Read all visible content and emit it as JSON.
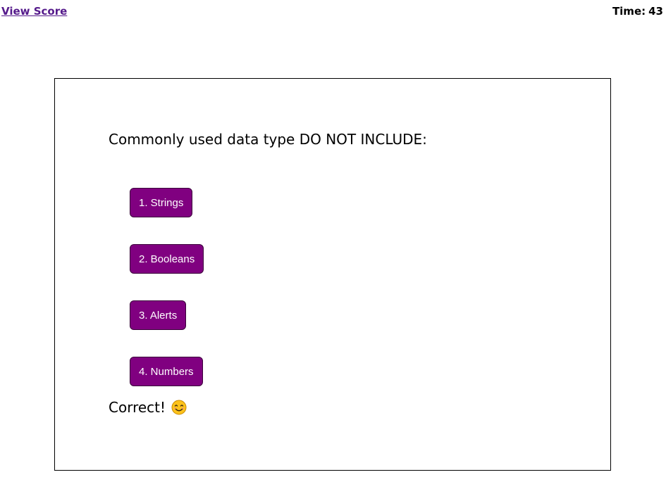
{
  "header": {
    "view_score_label": "View Score",
    "timer_label": "Time:",
    "timer_value": "43"
  },
  "quiz": {
    "question": "Commonly used data type DO NOT INCLUDE:",
    "answers": [
      {
        "label": "1. Strings"
      },
      {
        "label": "2. Booleans"
      },
      {
        "label": "3. Alerts"
      },
      {
        "label": "4. Numbers"
      }
    ],
    "feedback": "Correct!",
    "feedback_icon": "smiling-face-icon"
  },
  "colors": {
    "button_bg": "#800080",
    "link": "#551a8b"
  }
}
